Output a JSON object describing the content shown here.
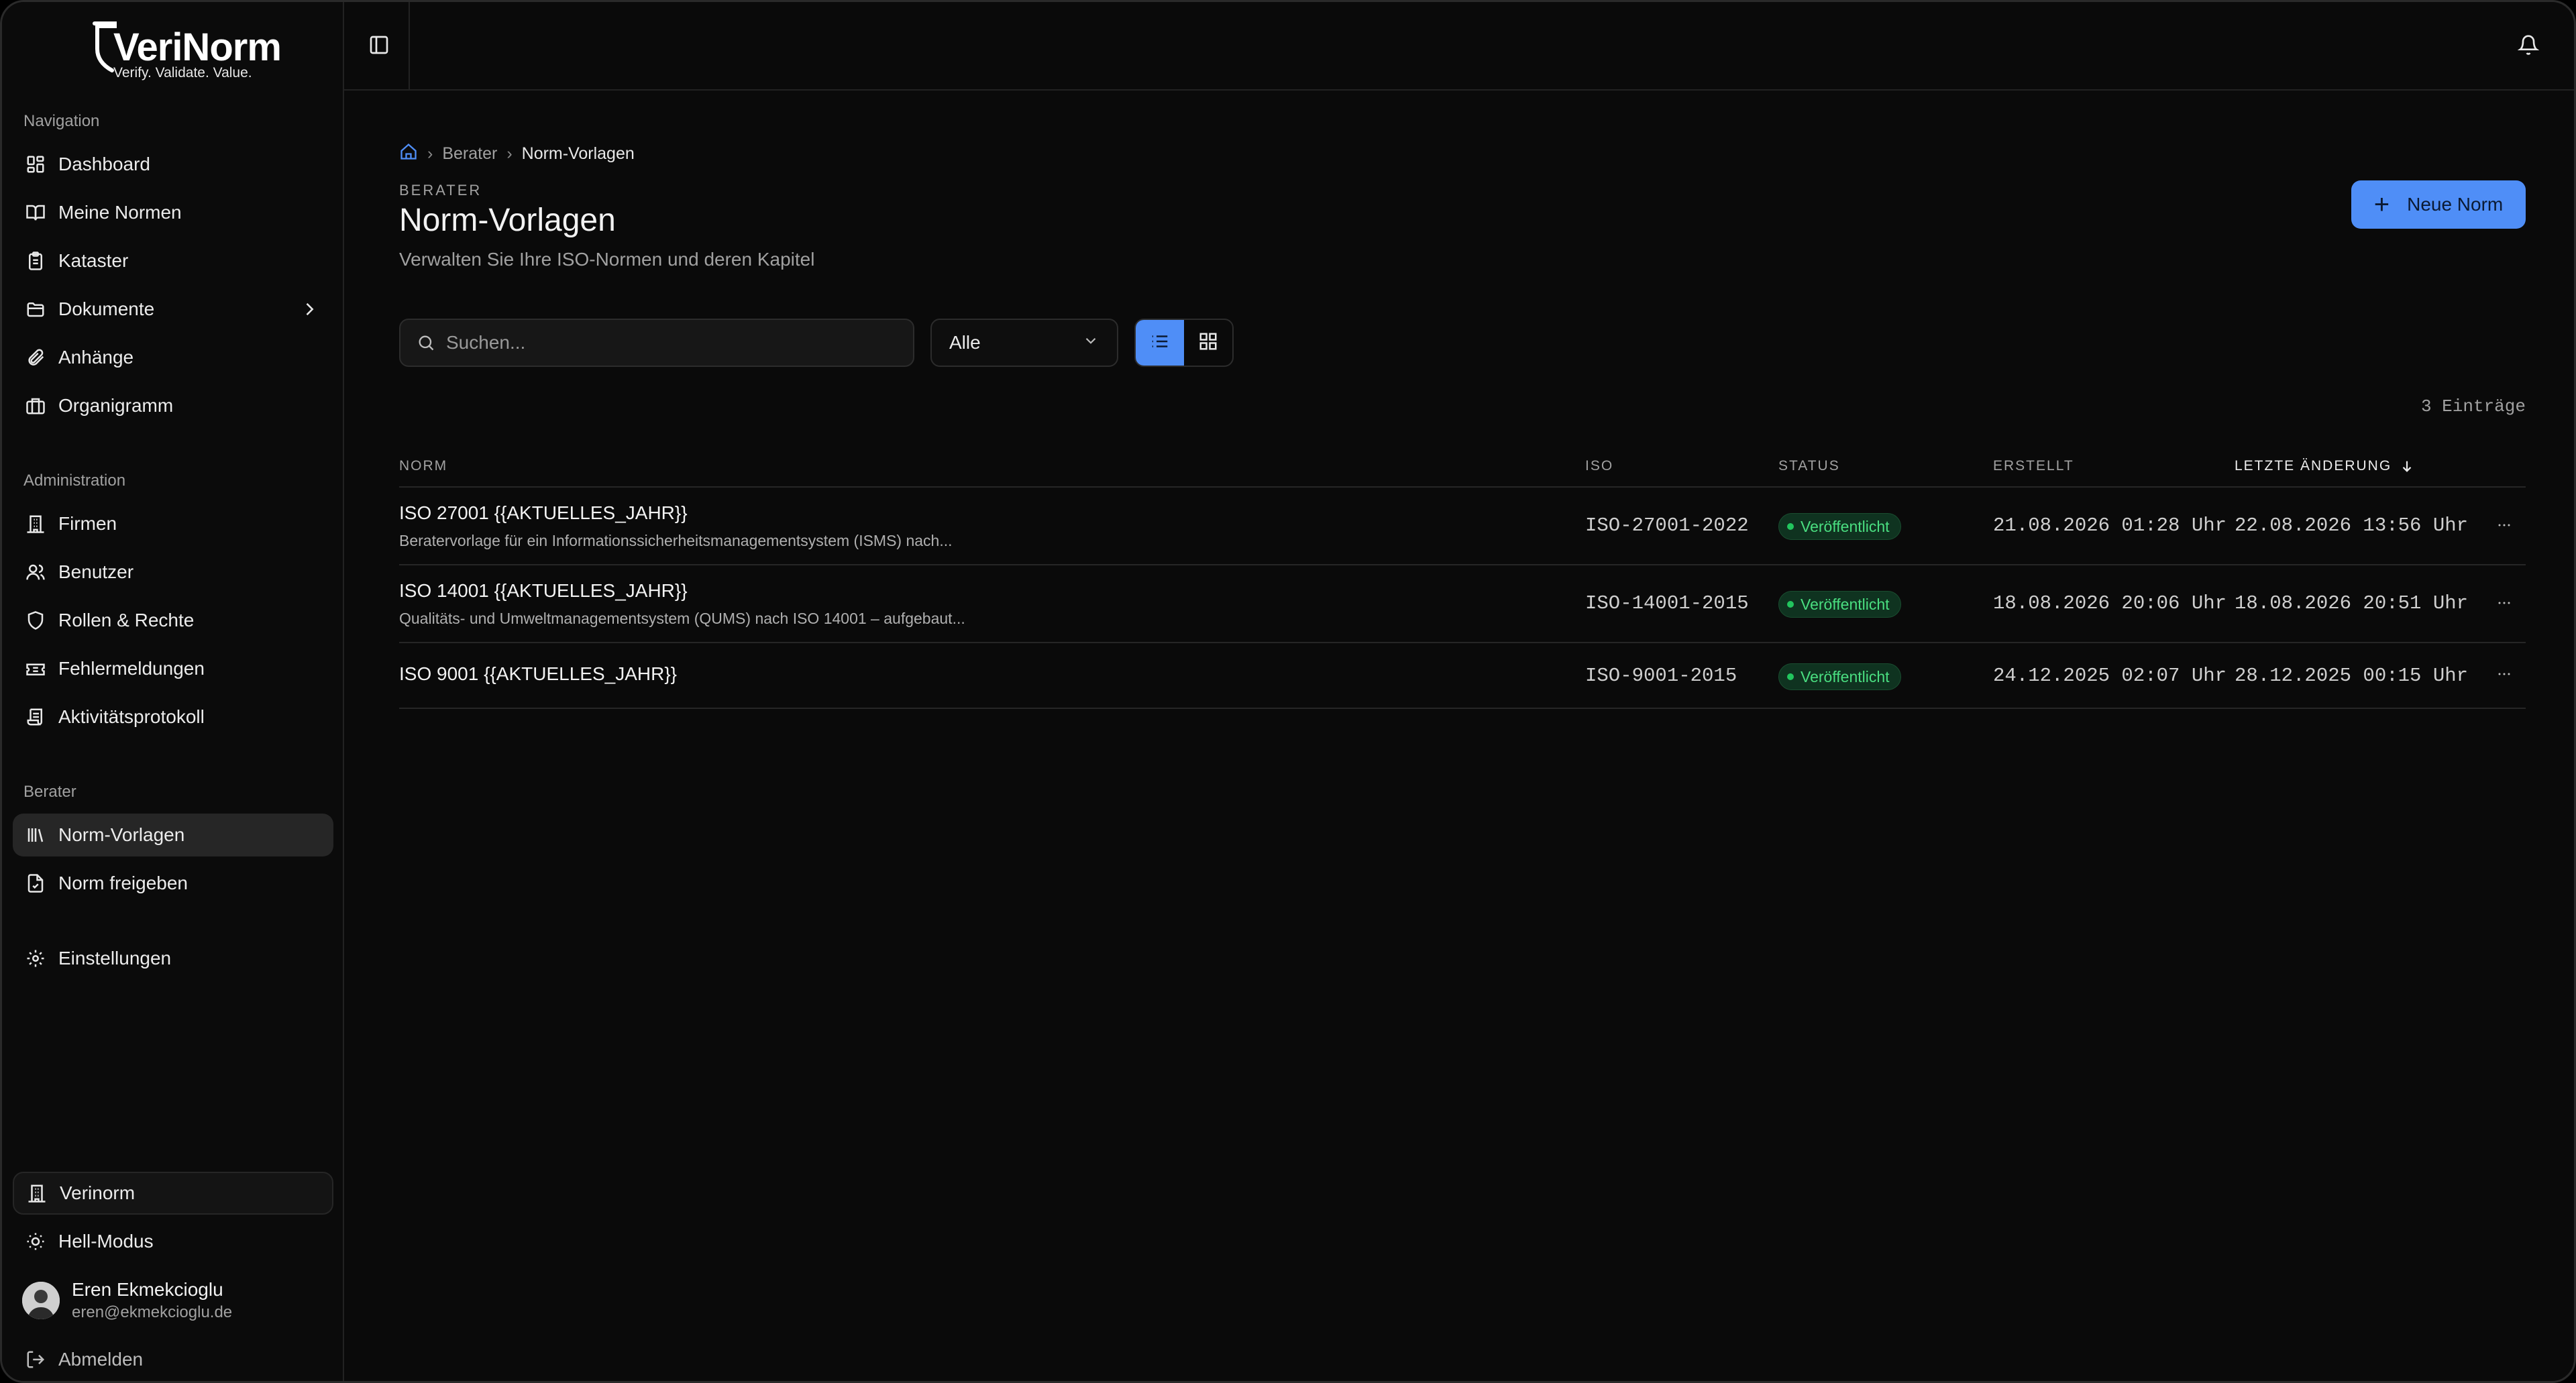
{
  "brand": {
    "name": "VeriNorm",
    "tagline": "Verify. Validate. Value."
  },
  "sidebar": {
    "sections": [
      {
        "label": "Navigation",
        "items": [
          {
            "label": "Dashboard",
            "icon": "dashboard-icon"
          },
          {
            "label": "Meine Normen",
            "icon": "book-icon"
          },
          {
            "label": "Kataster",
            "icon": "clipboard-icon"
          },
          {
            "label": "Dokumente",
            "icon": "folder-icon"
          },
          {
            "label": "Anhänge",
            "icon": "paperclip-icon"
          },
          {
            "label": "Organigramm",
            "icon": "briefcase-icon"
          }
        ]
      },
      {
        "label": "Administration",
        "items": [
          {
            "label": "Firmen",
            "icon": "building-icon"
          },
          {
            "label": "Benutzer",
            "icon": "users-icon"
          },
          {
            "label": "Rollen & Rechte",
            "icon": "shield-icon"
          },
          {
            "label": "Fehlermeldungen",
            "icon": "ticket-icon"
          },
          {
            "label": "Aktivitätsprotokoll",
            "icon": "scroll-icon"
          }
        ]
      },
      {
        "label": "Berater",
        "items": [
          {
            "label": "Norm-Vorlagen",
            "icon": "library-icon"
          },
          {
            "label": "Norm freigeben",
            "icon": "file-check-icon"
          }
        ]
      }
    ],
    "settings_label": "Einstellungen",
    "org_label": "Verinorm",
    "theme_label": "Hell-Modus",
    "user": {
      "name": "Eren Ekmekcioglu",
      "email": "eren@ekmekcioglu.de"
    },
    "logout_label": "Abmelden"
  },
  "breadcrumb": [
    "Berater",
    "Norm-Vorlagen"
  ],
  "page": {
    "eyebrow": "BERATER",
    "title": "Norm-Vorlagen",
    "subtitle": "Verwalten Sie Ihre ISO-Normen und deren Kapitel",
    "new_button": "Neue Norm"
  },
  "filters": {
    "search_placeholder": "Suchen...",
    "status_value": "Alle"
  },
  "count_label": "3 Einträge",
  "table": {
    "columns": [
      "NORM",
      "ISO",
      "STATUS",
      "ERSTELLT",
      "LETZTE ÄNDERUNG"
    ],
    "rows": [
      {
        "name": "ISO 27001 {{AKTUELLES_JAHR}}",
        "desc": "Beratervorlage für ein Informationssicherheitsmanagementsystem (ISMS) nach...",
        "iso": "ISO-27001-2022",
        "status": "Veröffentlicht",
        "created": "21.08.2026 01:28 Uhr",
        "updated": "22.08.2026 13:56 Uhr"
      },
      {
        "name": "ISO 14001 {{AKTUELLES_JAHR}}",
        "desc": "Qualitäts- und Umweltmanagementsystem (QUMS) nach ISO 14001 – aufgebaut...",
        "iso": "ISO-14001-2015",
        "status": "Veröffentlicht",
        "created": "18.08.2026 20:06 Uhr",
        "updated": "18.08.2026 20:51 Uhr"
      },
      {
        "name": "ISO 9001 {{AKTUELLES_JAHR}}",
        "desc": "",
        "iso": "ISO-9001-2015",
        "status": "Veröffentlicht",
        "created": "24.12.2025 02:07 Uhr",
        "updated": "28.12.2025 00:15 Uhr"
      }
    ]
  },
  "colors": {
    "accent": "#4f8ef7",
    "success": "#22c55e",
    "background": "#0a0a0a"
  }
}
